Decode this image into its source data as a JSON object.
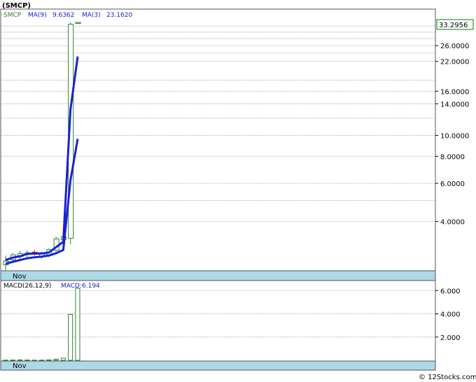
{
  "title": "(SMCP)",
  "watermark": "© 12Stocks.com",
  "price_panel": {
    "ticker_label": "SMCP",
    "ma9_label": "MA(9)",
    "ma9_value": "9.6362",
    "ma3_label": "MA(3)",
    "ma3_value": "23.1620",
    "last_price_badge": "33.2956",
    "y_ticks": [
      "26.0000",
      "22.0000",
      "16.0000",
      "14.0000",
      "10.0000",
      "8.0000",
      "6.0000",
      "4.0000"
    ],
    "x_label": "Nov"
  },
  "macd_panel": {
    "label": "MACD(26,12,9)",
    "value_label": "MACD:6.194",
    "y_ticks": [
      "6.000",
      "4.000",
      "2.000"
    ],
    "x_label": "Nov"
  },
  "colors": {
    "up_candle": "#2e7d32",
    "down_candle": "#e00000",
    "ma_line": "#1a22cc",
    "grid": "#b0b0b0",
    "axis_band": "#add8e6",
    "badge_border": "#008000"
  },
  "chart_data": [
    {
      "type": "candlestick",
      "title": "SMCP",
      "y_scale": "log",
      "ylim": [
        2.4,
        33.3
      ],
      "last_value": 33.2956,
      "candles": [
        {
          "open": 2.52,
          "high": 2.78,
          "low": 2.38,
          "close": 2.62
        },
        {
          "open": 2.66,
          "high": 2.86,
          "low": 2.58,
          "close": 2.8
        },
        {
          "open": 2.75,
          "high": 2.92,
          "low": 2.62,
          "close": 2.84
        },
        {
          "open": 2.82,
          "high": 2.94,
          "low": 2.72,
          "close": 2.86
        },
        {
          "open": 2.88,
          "high": 2.95,
          "low": 2.78,
          "close": 2.82
        },
        {
          "open": 2.76,
          "high": 2.9,
          "low": 2.68,
          "close": 2.84
        },
        {
          "open": 2.8,
          "high": 3.0,
          "low": 2.74,
          "close": 2.96
        },
        {
          "open": 2.94,
          "high": 3.4,
          "low": 2.9,
          "close": 3.32
        },
        {
          "open": 3.3,
          "high": 3.45,
          "low": 3.0,
          "close": 3.4
        },
        {
          "open": 3.34,
          "high": 33.3,
          "low": 3.14,
          "close": 32.6
        },
        {
          "open": 33.0,
          "high": 33.3,
          "low": 32.8,
          "close": 33.2956
        }
      ],
      "series": [
        {
          "name": "MA(3)",
          "values": [
            2.65,
            2.72,
            2.76,
            2.83,
            2.84,
            2.84,
            2.87,
            3.04,
            3.22,
            13.2,
            23.16
          ]
        },
        {
          "name": "MA(9)",
          "values": [
            2.55,
            2.6,
            2.65,
            2.7,
            2.73,
            2.75,
            2.78,
            2.85,
            2.95,
            6.2,
            9.6362
          ]
        }
      ]
    },
    {
      "type": "bar",
      "title": "MACD(26,12,9)",
      "ylim": [
        0,
        6.8
      ],
      "values": [
        0.02,
        0.03,
        0.04,
        0.03,
        0.02,
        0.02,
        0.04,
        0.1,
        0.18,
        3.95,
        6.194
      ]
    }
  ]
}
